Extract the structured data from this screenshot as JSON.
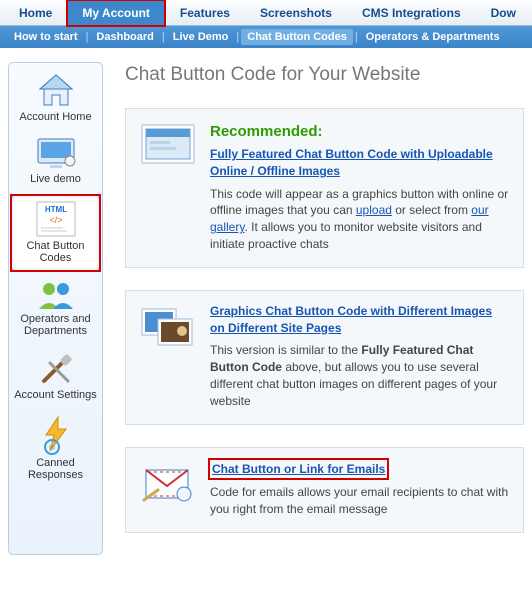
{
  "topnav": {
    "items": [
      "Home",
      "My Account",
      "Features",
      "Screenshots",
      "CMS Integrations",
      "Dow"
    ],
    "active_index": 1
  },
  "subnav": {
    "items": [
      "How to start",
      "Dashboard",
      "Live Demo",
      "Chat Button Codes",
      "Operators & Departments"
    ],
    "active_index": 3
  },
  "sidebar": {
    "items": [
      {
        "label": "Account Home",
        "icon": "home-icon"
      },
      {
        "label": "Live demo",
        "icon": "monitor-icon"
      },
      {
        "label": "Chat Button Codes",
        "icon": "html-code-icon",
        "selected": true,
        "highlighted": true
      },
      {
        "label": "Operators and Departments",
        "icon": "people-icon"
      },
      {
        "label": "Account Settings",
        "icon": "tools-icon"
      },
      {
        "label": "Canned Responses",
        "icon": "lightning-icon"
      }
    ]
  },
  "page": {
    "title": "Chat Button Code for Your Website"
  },
  "cards": [
    {
      "recommended_label": "Recommended:",
      "title": "Fully Featured Chat Button Code with Uploadable Online / Offline Images",
      "desc_pre": "This code will appear as a graphics button with online or offline images that you can ",
      "upload_link": "upload",
      "desc_mid": " or select from ",
      "gallery_link": "our gallery",
      "desc_post": ". It allows you to monitor website visitors and initiate proactive chats"
    },
    {
      "title": "Graphics Chat Button Code with Different Images on Different Site Pages",
      "desc_pre": "This version is similar to the ",
      "bold_ref": "Fully Featured Chat Button Code",
      "desc_post": " above, but allows you to use several different chat button images on different pages of your website"
    },
    {
      "title": "Chat Button or Link for Emails",
      "desc": "Code for emails allows your email recipients to chat with you right from the email message",
      "highlighted": true
    }
  ]
}
